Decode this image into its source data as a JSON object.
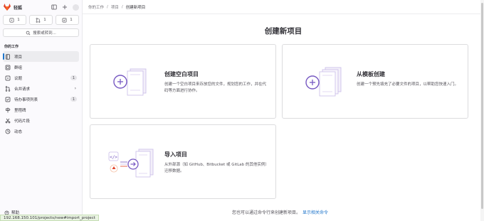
{
  "sidebar": {
    "brand": "轻狐",
    "counters": [
      {
        "icon": "issues-icon",
        "count": "1"
      },
      {
        "icon": "merge-request-icon",
        "count": "1"
      },
      {
        "icon": "todo-icon",
        "count": "1"
      }
    ],
    "search_label": "搜索或转到...",
    "section_title": "你的工作",
    "items": [
      {
        "label": "项目",
        "icon": "project-icon",
        "active": true
      },
      {
        "label": "群组",
        "icon": "group-icon"
      },
      {
        "label": "议题",
        "icon": "issues-icon",
        "badge": "1"
      },
      {
        "label": "合并请求",
        "icon": "merge-request-icon",
        "chevron": true
      },
      {
        "label": "待办事项列表",
        "icon": "todo-icon",
        "badge": "1"
      },
      {
        "label": "里程碑",
        "icon": "milestone-icon"
      },
      {
        "label": "代码片段",
        "icon": "snippet-icon"
      },
      {
        "label": "动态",
        "icon": "activity-icon"
      }
    ],
    "help_label": "帮助"
  },
  "breadcrumb": [
    "你的工作",
    "项目",
    "创建新项目"
  ],
  "page_title": "创建新项目",
  "cards": [
    {
      "title": "创建空白项目",
      "desc": "创建一个空白项目来存放您的文件，规划您的工作，并在代码等方面进行协作。"
    },
    {
      "title": "从模板创建",
      "desc": "创建一个预先填充了必要文件的项目，以帮助您快速入门。"
    },
    {
      "title": "导入项目",
      "desc": "从外部源（如 GitHub、Bitbucket 或 GitLab 的其他实例）迁移数据。"
    }
  ],
  "footer": {
    "text": "您也可以通过命令行来创建新项目。",
    "link": "显示相关命令"
  },
  "status_url": "192.168.150.101/projects/new#import_project",
  "colors": {
    "accent": "#7759c2",
    "link": "#1f75cb",
    "brand_orange": "#e24329"
  }
}
